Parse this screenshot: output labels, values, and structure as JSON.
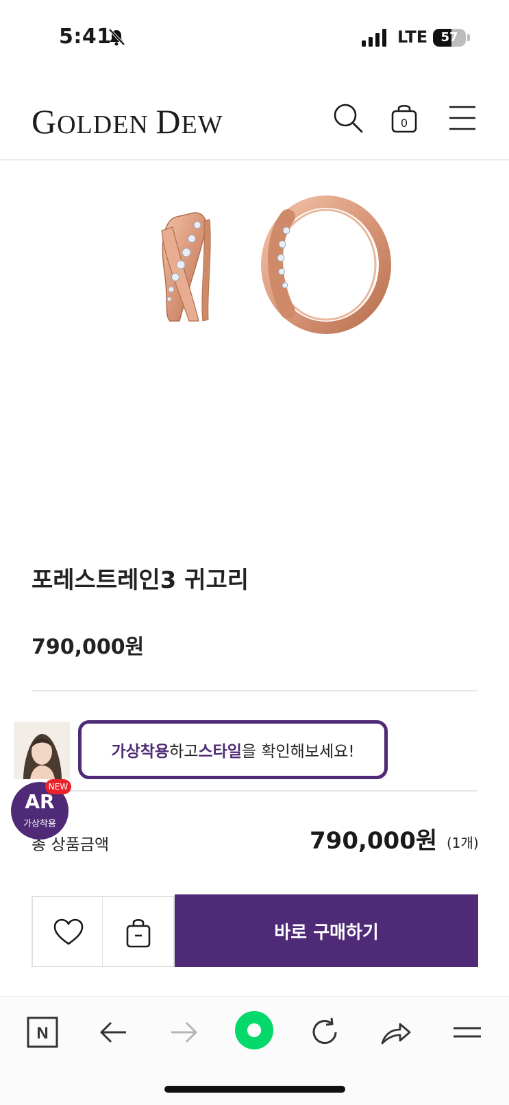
{
  "status_bar": {
    "time": "5:41",
    "network": "LTE",
    "battery": "57",
    "battery_level": 0.57
  },
  "header": {
    "logo_initial": "G",
    "logo_rest": "OLDEN ",
    "logo_initial2": "D",
    "logo_rest2": "EW",
    "cart_count": "0",
    "icons": [
      "search-icon",
      "shopping-bag-icon",
      "menu-icon"
    ]
  },
  "product": {
    "name": "포레스트레인3 귀고리",
    "price": "790,000원",
    "image": "rose-gold-hoop-earrings"
  },
  "ar_promo": {
    "highlight1": "가상착용",
    "text1": "하고 ",
    "highlight2": "스타일",
    "text2": "을 확인해보세요!",
    "badge_big": "AR",
    "badge_small": "가상착용",
    "new_label": "NEW"
  },
  "totals": {
    "label": "총 상품금액",
    "amount": "790,000원",
    "quantity": "(1개)"
  },
  "actions": {
    "buy_now": "바로 구매하기",
    "icons": [
      "heart-icon",
      "shopping-bag-icon"
    ]
  },
  "browser_toolbar": {
    "icons": [
      "naver-n-icon",
      "back-arrow-icon",
      "forward-arrow-icon",
      "green-dot-home-icon",
      "reload-icon",
      "share-icon",
      "menu-icon"
    ],
    "n_letter": "N"
  },
  "colors": {
    "brand_purple": "#4f2a76",
    "new_red": "#e8232b",
    "rose_gold": "#d9977a",
    "green_button": "#06d96b"
  }
}
